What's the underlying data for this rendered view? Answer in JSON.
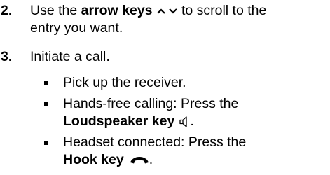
{
  "steps": [
    {
      "number": "2.",
      "line1_before": "Use the ",
      "line1_bold": "arrow keys",
      "arrow_icons": [
        "up-arrow-icon",
        "down-arrow-icon"
      ],
      "line1_after": " to scroll to the",
      "line2": "entry you want."
    },
    {
      "number": "3.",
      "text": "Initiate a call."
    }
  ],
  "bullets": [
    {
      "text": "Pick up the receiver."
    },
    {
      "line1": "Hands-free calling: Press the",
      "line2_bold": "Loudspeaker key",
      "line2_icon": "loudspeaker-icon",
      "line2_after": "."
    },
    {
      "line1": "Headset connected: Press the",
      "line2_bold": "Hook key",
      "line2_icon": "handset-icon",
      "line2_after": "."
    }
  ]
}
